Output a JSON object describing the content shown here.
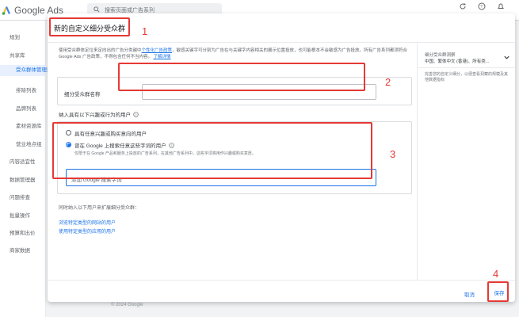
{
  "app": {
    "logo_text": "Google Ads",
    "search_placeholder": "搜索页面或广告系列"
  },
  "sidenav": {
    "items": [
      {
        "label": "规划",
        "level": "top"
      },
      {
        "label": "共享库",
        "level": "top"
      },
      {
        "label": "受众群体管理器",
        "level": "active"
      },
      {
        "label": "排除列表",
        "level": "sub"
      },
      {
        "label": "品牌列表",
        "level": "sub"
      },
      {
        "label": "素材资源库",
        "level": "sub"
      },
      {
        "label": "营业地点组",
        "level": "sub"
      },
      {
        "label": "内容适宜性",
        "level": "top"
      },
      {
        "label": "数据管理器",
        "level": "top"
      },
      {
        "label": "问题排查",
        "level": "top"
      },
      {
        "label": "批量操作",
        "level": "top"
      },
      {
        "label": "预算和出价",
        "level": "top"
      },
      {
        "label": "商家数据",
        "level": "top"
      }
    ]
  },
  "modal": {
    "title": "新的自定义细分受众群",
    "intro": "使用受众群体定位来定向出的广告分类越中",
    "intro_link": "个性化广告政策",
    "intro_rest": "，敏感关键字可分别为广告在与关键字内容相关的展示位置投放，也可能根本不会敏感为广告投放。所有广告系列都须符合 Google Ads 广告政策，不得包含任何不当内容。",
    "intro_link2": "了解详情",
    "name_label": "细分受众群名称",
    "name_value": "",
    "interest_title": "纳入具有以下兴趣或行为的用户",
    "option1": "具有任意兴趣或购买意向的用户",
    "option2": "曾在 Google 上搜索任意这些字词的用户",
    "option2_sub": "仅限于在 Google 产品和服务上投放的广告系列，在其他广告系列中，这些字词将用作兴趣或购买意愿。",
    "keyword_placeholder": "添加 Google 搜索字词",
    "expand_text": "同时纳入以下用户来扩展细分受众群：",
    "link1": "浏览特定类型的网站的用户",
    "link2": "使用特定类型的应用的用户",
    "cancel_label": "取消",
    "save_label": "保存"
  },
  "side_panel": {
    "title": "细分受众群洞察",
    "value": "中国、繁体中文 (香港)、所有类...",
    "desc": "完善您的自定义细分，以便查看洞察的规模及其他数据指标"
  },
  "footer": {
    "text": "© 2024 Google"
  },
  "annotations": [
    "1",
    "2",
    "3",
    "4"
  ]
}
